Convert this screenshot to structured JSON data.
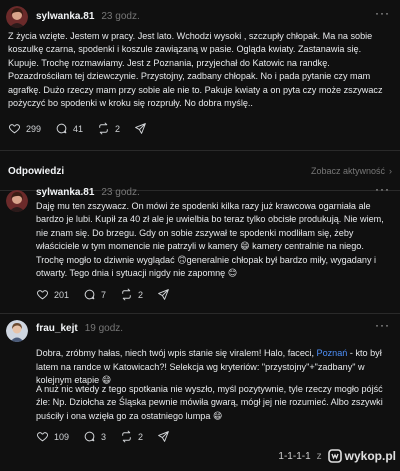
{
  "posts": [
    {
      "author": "sylwanka.81",
      "time": "23 godz.",
      "more": "···",
      "text": "Z życia wzięte. Jestem w pracy. Jest lato. Wchodzi wysoki , szczupły chłopak. Ma na sobie koszulkę czarna, spodenki i koszule zawiązaną w pasie. Ogląda kwiaty. Zastanawia się. Kupuje. Trochę rozmawiamy. Jest z Poznania, przyjechał do Katowic na randkę. Pozazdrościłam tej dziewczynie. Przystojny, zadbany chłopak. No i pada pytanie czy mam agrafkę. Dużo rzeczy mam przy sobie ale nie to. Pakuje kwiaty a on pyta czy może zszywacz pożyczyć bo spodenki w kroku się rozpruły. No dobra myślę..",
      "likes": "299",
      "comments": "41",
      "reposts": "2"
    },
    {
      "author": "sylwanka.81",
      "time": "23 godz.",
      "more": "···",
      "text": "Daję mu ten zszywacz. On mówi że spodenki kilka razy już krawcowa ogarniała ale bardzo je lubi. Kupił za 40 zł ale je uwielbia bo teraz tylko obcisłe produkują. Nie wiem, nie znam się. Do brzegu. Gdy on sobie zszywał te spodenki modliłam się, żeby właściciele w tym momencie nie patrzyli w kamery 😄 kamery centralnie na niego. Trochę mogło to dziwnie wyglądać 🙃generalnie chłopak był bardzo miły, wygadany i otwarty. Tego dnia i sytuacji nigdy nie zapomnę 😊",
      "likes": "201",
      "comments": "7",
      "reposts": "2"
    },
    {
      "author": "frau_kejt",
      "time": "19 godz.",
      "more": "···",
      "text_part1": "Dobra, zróbmy hałas, niech twój wpis stanie się viralem! Halo, faceci, ",
      "text_link": "Poznań",
      "text_part2": " - kto był latem na randce w Katowicach?! Selekcja wg kryteriów: \"przystojny\"+\"zadbany\" w kolejnym etapie 😄",
      "text_second": "A nuż nic wtedy z tego spotkania nie wyszło, myśl pozytywnie, tyle rzeczy mogło pójść źle: Np. Dziołcha ze Śląska pewnie mówiła gwarą, mógł jej nie rozumieć. Albo zszywki puściły i ona wzięła go za ostatniego lumpa 😄",
      "likes": "109",
      "comments": "3",
      "reposts": "2"
    }
  ],
  "replies_section": {
    "title": "Odpowiedzi",
    "activity_label": "Zobacz aktywność"
  },
  "watermark": {
    "numbers": "1-1-1-1",
    "letter": "z",
    "brand": "wykop.pl"
  },
  "colors": {
    "background": "#101010",
    "link": "#4d8ff8",
    "muted": "#777777"
  }
}
